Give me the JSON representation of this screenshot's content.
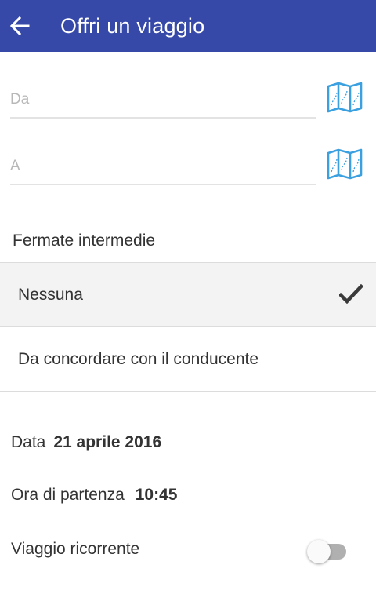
{
  "header": {
    "title": "Offri un viaggio",
    "bg_color": "#3649a8"
  },
  "form": {
    "from_placeholder": "Da",
    "to_placeholder": "A",
    "from_value": "",
    "to_value": ""
  },
  "stops": {
    "label": "Fermate intermedie",
    "options": [
      {
        "label": "Nessuna",
        "selected": true
      },
      {
        "label": "Da concordare con il conducente",
        "selected": false
      }
    ]
  },
  "date": {
    "label": "Data",
    "value": "21 aprile 2016"
  },
  "departure": {
    "label": "Ora di partenza",
    "value": "10:45"
  },
  "recurring": {
    "label": "Viaggio ricorrente",
    "enabled": false
  },
  "icons": {
    "back": "arrow-left-icon",
    "map": "map-icon",
    "check": "check-icon"
  },
  "colors": {
    "accent": "#3649a8",
    "map_icon": "#3aa0e0"
  }
}
